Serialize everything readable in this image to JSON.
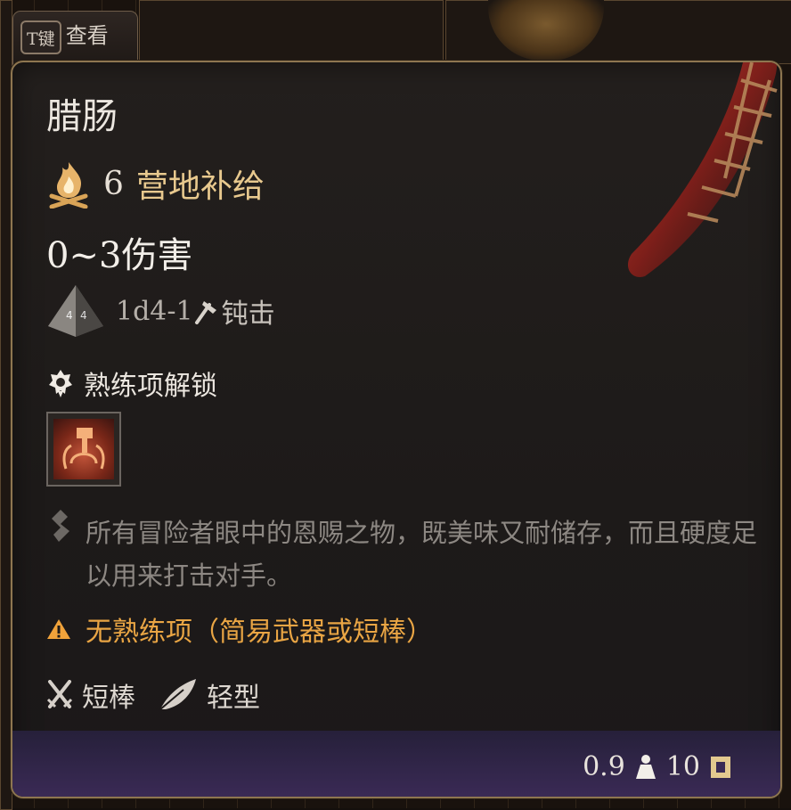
{
  "hint": {
    "key": "T键",
    "label": "查看"
  },
  "item": {
    "name": "腊肠",
    "camp_supply_value": "6",
    "camp_supply_label": "营地补给",
    "damage": "0~3伤害",
    "dice": "1d4-1",
    "damage_type": "钝击",
    "proficiency_label": "熟练项解锁",
    "description": "所有冒险者眼中的恩赐之物，既美味又耐储存，而且硬度足以用来打击对手。",
    "warning": "无熟练项（简易武器或短棒）",
    "weapon_type": "短棒",
    "property": "轻型",
    "weight": "0.9",
    "price": "10"
  },
  "colors": {
    "gold_text": "#e8c98e",
    "warning": "#e9a544",
    "border": "#8e7650"
  },
  "icons": [
    "camp-supply-icon",
    "d4-dice-icon",
    "bludgeon-icon",
    "proficiency-icon",
    "flavor-icon",
    "warning-icon",
    "crossed-swords-icon",
    "feather-icon",
    "weight-icon",
    "gold-icon"
  ]
}
